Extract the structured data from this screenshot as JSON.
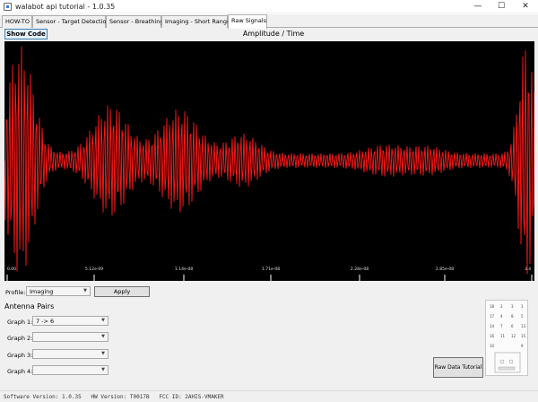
{
  "window": {
    "title": "walabot api tutorial - 1.0.35",
    "minimize": "—",
    "maximize": "☐",
    "close": "✕"
  },
  "tabs": [
    {
      "label": "HOW-TO",
      "active": false
    },
    {
      "label": "Sensor - Target Detection",
      "active": false
    },
    {
      "label": "Sensor - Breathing",
      "active": false
    },
    {
      "label": "Imaging - Short Range",
      "active": false
    },
    {
      "label": "Raw Signals",
      "active": true
    }
  ],
  "toolbar": {
    "show_code_label": "Show Code"
  },
  "chart": {
    "title": "Amplitude / Time",
    "background": "#000000",
    "signal_color": "#ff1a1a",
    "x_tick_labels": [
      "0.00",
      "5.12e-09",
      "1.14e-08",
      "1.71e-08",
      "2.28e-08",
      "2.85e-08",
      "3.4"
    ]
  },
  "controls": {
    "profile_label": "Profile:",
    "profile_value": "Imaging",
    "apply_label": "Apply"
  },
  "antenna": {
    "section_title": "Antenna Pairs",
    "graphs": [
      {
        "label": "Graph 1:",
        "value": "7 -> 6"
      },
      {
        "label": "Graph 2:",
        "value": ""
      },
      {
        "label": "Graph 3:",
        "value": ""
      },
      {
        "label": "Graph 4:",
        "value": ""
      }
    ],
    "tutorial_label": "Raw Data Tutorial",
    "board_numbers": [
      "18",
      "2",
      "3",
      "1",
      "17",
      "4",
      "8",
      "5",
      "14",
      "7",
      "6",
      "13",
      "16",
      "11",
      "12",
      "15",
      "10",
      "9"
    ]
  },
  "status": {
    "text": "Software Version: 1.0.35   HW Version: T0017B   FCC ID: 2AHIS-VMAKER"
  }
}
